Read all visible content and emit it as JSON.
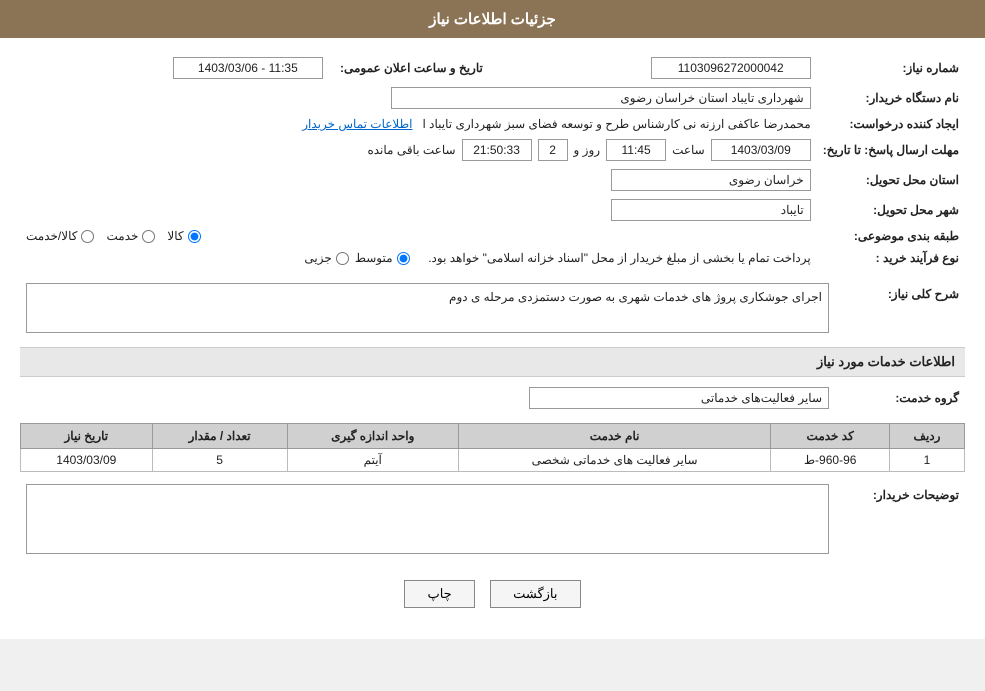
{
  "header": {
    "title": "جزئیات اطلاعات نیاز"
  },
  "form": {
    "shomareNiaz_label": "شماره نیاز:",
    "shomareNiaz_value": "1103096272000042",
    "namDastgah_label": "نام دستگاه خریدار:",
    "namDastgah_value": "شهرداری تایباد استان خراسان رضوی",
    "ijadKonande_label": "ایجاد کننده درخواست:",
    "ijadKonande_value": "محمدرضا عاکفی ارزنه نی کارشناس طرح و توسعه فضای سبز شهرداری تایباد ا",
    "ijadKonande_link": "اطلاعات تماس خریدار",
    "tarikhErsalPasokh_label": "مهلت ارسال پاسخ: تا تاریخ:",
    "tarikhErsalDate": "1403/03/09",
    "tarikhErsalSaat_label": "ساعت",
    "tarikhErsalSaat": "11:45",
    "tarikhErsalRoz_label": "روز و",
    "tarikhErsalRoz": "2",
    "tarikhErsalBaqi_label": "ساعت باقی مانده",
    "tarikhErsalBaqi": "21:50:33",
    "tarikhVaSaat_label": "تاریخ و ساعت اعلان عمومی:",
    "tarikhVaSaat_value": "1403/03/06 - 11:35",
    "ostanTahvil_label": "استان محل تحویل:",
    "ostanTahvil_value": "خراسان رضوی",
    "shahrTahvil_label": "شهر محل تحویل:",
    "shahrTahvil_value": "تایباد",
    "tabaghebandi_label": "طبقه بندی موضوعی:",
    "tabaghebandi_options": [
      "کالا",
      "خدمت",
      "کالا/خدمت"
    ],
    "tabaghebandi_selected": "کالا",
    "noeFarayand_label": "نوع فرآیند خرید :",
    "noeFarayand_options": [
      "جزیی",
      "متوسط"
    ],
    "noeFarayand_selected": "متوسط",
    "noeFarayand_notice": "پرداخت تمام یا بخشی از مبلغ خریدار از محل \"اسناد خزانه اسلامی\" خواهد بود.",
    "sharhKolli_label": "شرح کلی نیاز:",
    "sharhKolli_value": "اجرای جوشکاری پروژ های خدمات شهری به صورت دستمزدی مرحله ی دوم",
    "section_service": "اطلاعات خدمات مورد نیاز",
    "grohKhadmat_label": "گروه خدمت:",
    "grohKhadmat_value": "سایر فعالیت‌های خدماتی",
    "table": {
      "headers": [
        "ردیف",
        "کد خدمت",
        "نام خدمت",
        "واحد اندازه گیری",
        "تعداد / مقدار",
        "تاریخ نیاز"
      ],
      "rows": [
        {
          "radif": "1",
          "kod": "960-96-ط",
          "name": "سایر فعالیت های خدماتی شخصی",
          "vahed": "آیتم",
          "tedad": "5",
          "tarikh": "1403/03/09"
        }
      ]
    },
    "tosifat_label": "توضیحات خریدار:",
    "tosifat_value": "",
    "btn_print": "چاپ",
    "btn_back": "بازگشت"
  }
}
